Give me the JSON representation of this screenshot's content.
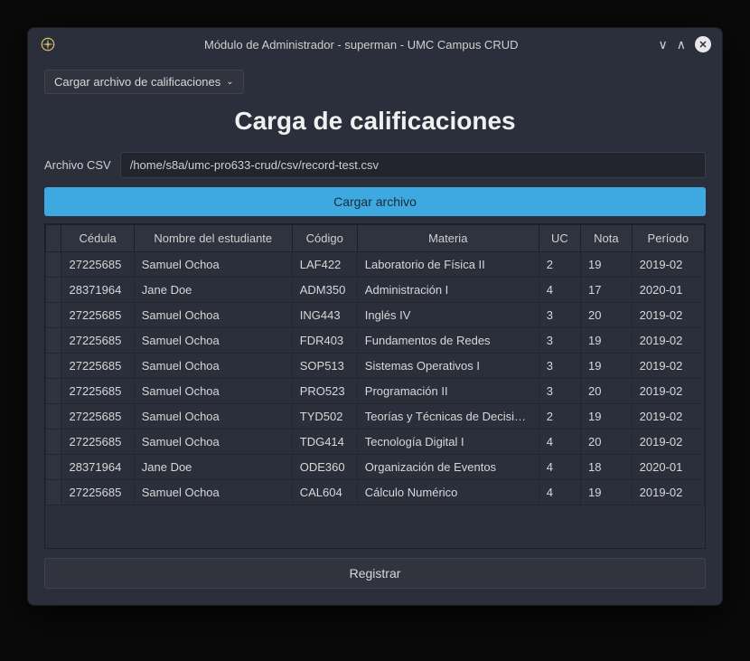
{
  "window": {
    "title": "Módulo de Administrador - superman - UMC Campus CRUD"
  },
  "dropdown": {
    "label": "Cargar archivo de calificaciones"
  },
  "page": {
    "title": "Carga de calificaciones"
  },
  "file": {
    "label": "Archivo CSV",
    "path": "/home/s8a/umc-pro633-crud/csv/record-test.csv"
  },
  "buttons": {
    "load": "Cargar archivo",
    "register": "Registrar"
  },
  "table": {
    "headers": {
      "cedula": "Cédula",
      "nombre": "Nombre del estudiante",
      "codigo": "Código",
      "materia": "Materia",
      "uc": "UC",
      "nota": "Nota",
      "periodo": "Período"
    },
    "rows": [
      {
        "cedula": "27225685",
        "nombre": "Samuel Ochoa",
        "codigo": "LAF422",
        "materia": "Laboratorio de Física II",
        "uc": "2",
        "nota": "19",
        "periodo": "2019-02"
      },
      {
        "cedula": "28371964",
        "nombre": "Jane Doe",
        "codigo": "ADM350",
        "materia": "Administración I",
        "uc": "4",
        "nota": "17",
        "periodo": "2020-01"
      },
      {
        "cedula": "27225685",
        "nombre": "Samuel Ochoa",
        "codigo": "ING443",
        "materia": "Inglés IV",
        "uc": "3",
        "nota": "20",
        "periodo": "2019-02"
      },
      {
        "cedula": "27225685",
        "nombre": "Samuel Ochoa",
        "codigo": "FDR403",
        "materia": "Fundamentos de Redes",
        "uc": "3",
        "nota": "19",
        "periodo": "2019-02"
      },
      {
        "cedula": "27225685",
        "nombre": "Samuel Ochoa",
        "codigo": "SOP513",
        "materia": "Sistemas Operativos I",
        "uc": "3",
        "nota": "19",
        "periodo": "2019-02"
      },
      {
        "cedula": "27225685",
        "nombre": "Samuel Ochoa",
        "codigo": "PRO523",
        "materia": "Programación II",
        "uc": "3",
        "nota": "20",
        "periodo": "2019-02"
      },
      {
        "cedula": "27225685",
        "nombre": "Samuel Ochoa",
        "codigo": "TYD502",
        "materia": "Teorías y Técnicas de Decisi…",
        "uc": "2",
        "nota": "19",
        "periodo": "2019-02"
      },
      {
        "cedula": "27225685",
        "nombre": "Samuel Ochoa",
        "codigo": "TDG414",
        "materia": "Tecnología Digital I",
        "uc": "4",
        "nota": "20",
        "periodo": "2019-02"
      },
      {
        "cedula": "28371964",
        "nombre": "Jane Doe",
        "codigo": "ODE360",
        "materia": "Organización de Eventos",
        "uc": "4",
        "nota": "18",
        "periodo": "2020-01"
      },
      {
        "cedula": "27225685",
        "nombre": "Samuel Ochoa",
        "codigo": "CAL604",
        "materia": "Cálculo Numérico",
        "uc": "4",
        "nota": "19",
        "periodo": "2019-02"
      }
    ]
  }
}
